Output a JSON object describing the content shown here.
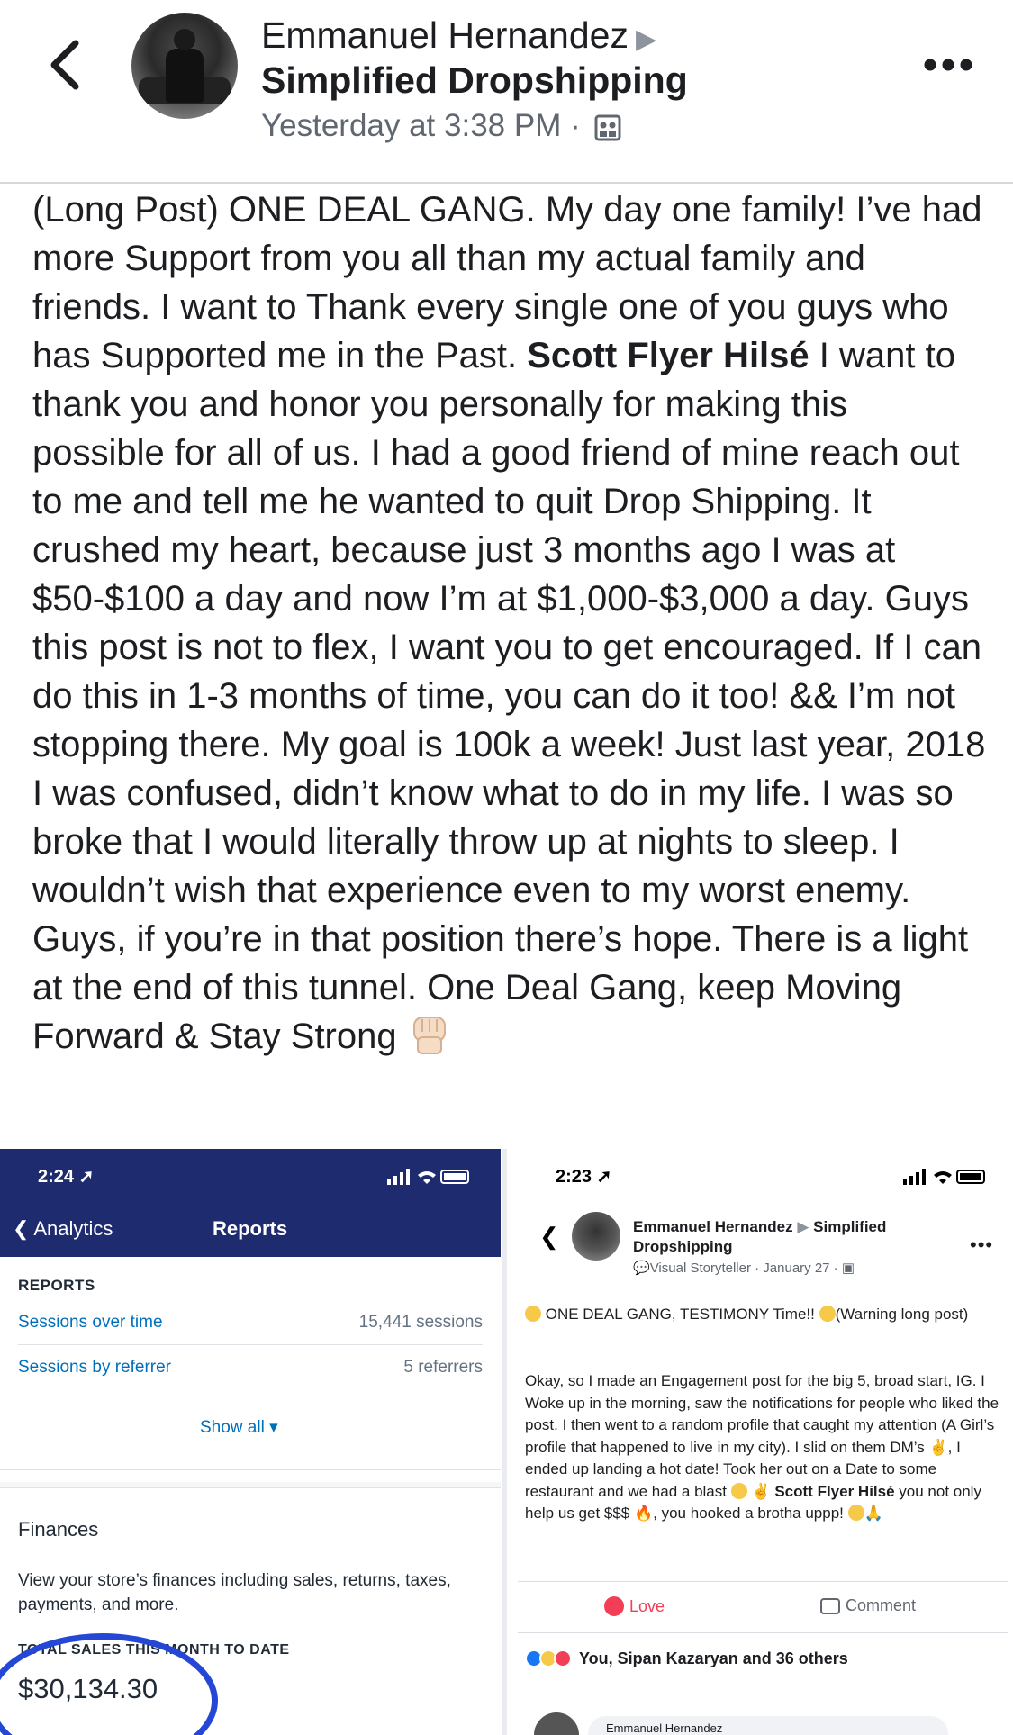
{
  "header": {
    "author": "Emmanuel Hernandez",
    "arrow": "▶",
    "group": "Simplified Dropshipping",
    "timestamp": "Yesterday at 3:38 PM ·"
  },
  "post": {
    "text_before": "(Long Post) ONE DEAL GANG. My day one family! I’ve had more Support from you all than my actual family and friends. I want to Thank every single one of you guys who has Supported me in the Past. ",
    "mention": "Scott Flyer Hilsé",
    "text_after": " I want to thank you and honor you personally for making this possible for all of us. I had a good friend of mine reach out to me and tell me he wanted to quit Drop Shipping. It crushed my heart, because just 3 months ago I was at $50-$100 a day and now I’m at $1,000-$3,000 a day. Guys this post is not to flex, I want you to get encouraged. If I can do this in 1-3 months of time, you can do it too! && I’m not stopping there. My goal is 100k a week! Just last year, 2018 I was confused, didn’t know what to do in my life. I was so broke that I would literally throw up at nights to sleep. I wouldn’t wish that experience even to my worst enemy. Guys, if you’re in that position there’s hope. There is a light at the end of this tunnel. One Deal Gang, keep Moving Forward & Stay Strong",
    "emoji_icon": "raised-fist-icon"
  },
  "shopify": {
    "time": "2:24",
    "back_label": "Analytics",
    "title": "Reports",
    "reports_heading": "REPORTS",
    "rows": [
      {
        "label": "Sessions over time",
        "value": "15,441 sessions"
      },
      {
        "label": "Sessions by referrer",
        "value": "5 referrers"
      }
    ],
    "show_all": "Show all ▾",
    "finances_heading": "Finances",
    "finances_desc": "View your store’s finances including sales, returns, taxes, payments, and more.",
    "total_label": "TOTAL SALES THIS MONTH TO DATE",
    "total_value": "$30,134.30",
    "bar_color": "#1e2b6e",
    "circle_color": "#2447d6"
  },
  "fb_shot": {
    "time": "2:23",
    "author": "Emmanuel Hernandez",
    "arrow": "▶",
    "group": "Simplified Dropshipping",
    "meta": "Visual Storyteller · January 27 ·",
    "line1": " ONE DEAL GANG, TESTIMONY Time!! ",
    "line1_end": "(Warning long post)",
    "body_before": "Okay, so I made an Engagement post for the big 5, broad start, IG. I Woke up in the morning, saw the notifications for people who liked the post. I then went to a random profile that caught my attention (A Girl’s profile that happened to live in my city). I slid on them DM’s ",
    "body_mid": ", I ended up landing a hot date! Took her out on a Date to some restaurant and we had a blast ",
    "mention": "Scott Flyer Hilsé",
    "body_after": " you not only help us get $$$ ",
    "body_end": ", you hooked a brotha uppp! ",
    "love": "Love",
    "comment": "Comment",
    "reactions": "You, Sipan Kazaryan and 36 others",
    "comment_name": "Emmanuel Hernandez"
  }
}
